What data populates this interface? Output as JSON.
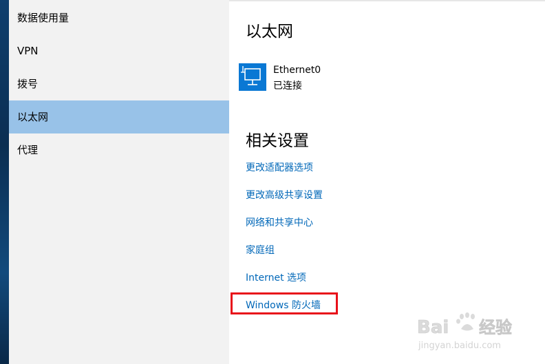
{
  "sidebar": {
    "items": [
      {
        "label": "数据使用量",
        "selected": false
      },
      {
        "label": "VPN",
        "selected": false
      },
      {
        "label": "拨号",
        "selected": false
      },
      {
        "label": "以太网",
        "selected": true
      },
      {
        "label": "代理",
        "selected": false
      }
    ]
  },
  "main": {
    "title": "以太网",
    "ethernet": {
      "icon": "ethernet-monitor-icon",
      "name": "Ethernet0",
      "status": "已连接"
    },
    "related_title": "相关设置",
    "links": [
      "更改适配器选项",
      "更改高级共享设置",
      "网络和共享中心",
      "家庭组",
      "Internet 选项",
      "Windows 防火墙"
    ]
  },
  "watermark": {
    "brand_left": "Bai",
    "brand_right": "经验",
    "url": "jingyan.baidu.com"
  },
  "colors": {
    "accent": "#0a78d4",
    "link": "#0067b8",
    "selected": "#98c2e8",
    "highlight": "#e8101a"
  }
}
